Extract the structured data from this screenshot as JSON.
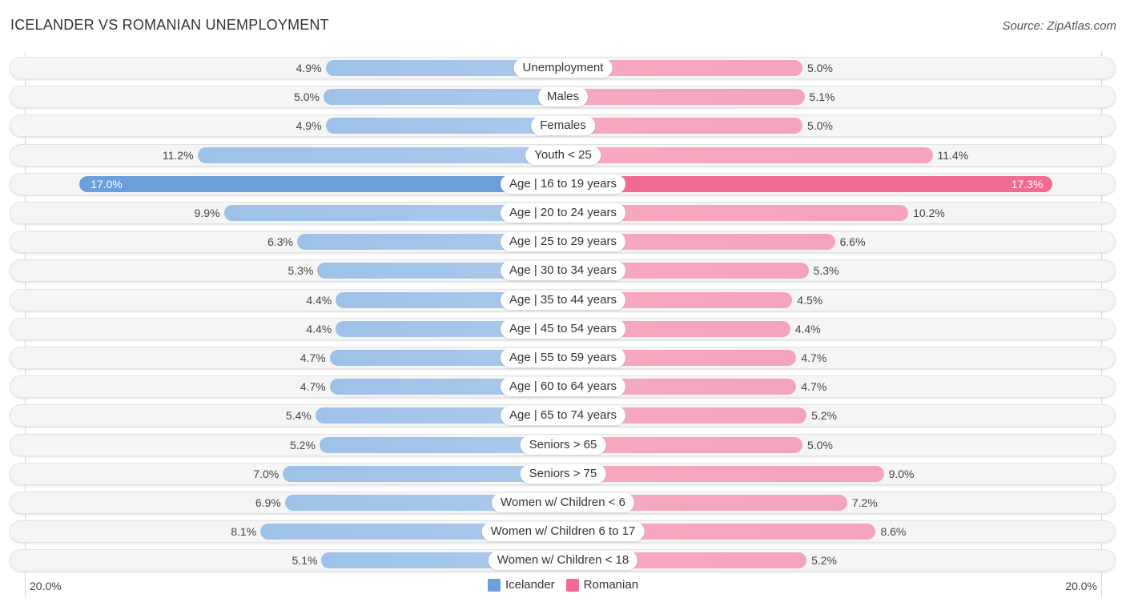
{
  "title": "ICELANDER VS ROMANIAN UNEMPLOYMENT",
  "source": "Source: ZipAtlas.com",
  "colors": {
    "icelander": "#6a9fdc",
    "romanian": "#f06a93"
  },
  "chart_data": {
    "type": "bar",
    "orientation": "horizontal-diverging",
    "title": "ICELANDER VS ROMANIAN UNEMPLOYMENT",
    "xlabel": "",
    "ylabel": "",
    "axis_range": [
      0,
      20.0
    ],
    "tick_labels": {
      "left": "20.0%",
      "right": "20.0%"
    },
    "legend": {
      "position": "bottom-center",
      "entries": [
        "Icelander",
        "Romanian"
      ]
    },
    "categories": [
      "Unemployment",
      "Males",
      "Females",
      "Youth < 25",
      "Age | 16 to 19 years",
      "Age | 20 to 24 years",
      "Age | 25 to 29 years",
      "Age | 30 to 34 years",
      "Age | 35 to 44 years",
      "Age | 45 to 54 years",
      "Age | 55 to 59 years",
      "Age | 60 to 64 years",
      "Age | 65 to 74 years",
      "Seniors > 65",
      "Seniors > 75",
      "Women w/ Children < 6",
      "Women w/ Children 6 to 17",
      "Women w/ Children < 18"
    ],
    "series": [
      {
        "name": "Icelander",
        "side": "left",
        "values": [
          4.9,
          5.0,
          4.9,
          11.2,
          17.0,
          9.9,
          6.3,
          5.3,
          4.4,
          4.4,
          4.7,
          4.7,
          5.4,
          5.2,
          7.0,
          6.9,
          8.1,
          5.1
        ],
        "labels": [
          "4.9%",
          "5.0%",
          "4.9%",
          "11.2%",
          "17.0%",
          "9.9%",
          "6.3%",
          "5.3%",
          "4.4%",
          "4.4%",
          "4.7%",
          "4.7%",
          "5.4%",
          "5.2%",
          "7.0%",
          "6.9%",
          "8.1%",
          "5.1%"
        ]
      },
      {
        "name": "Romanian",
        "side": "right",
        "values": [
          5.0,
          5.1,
          5.0,
          11.4,
          17.3,
          10.2,
          6.6,
          5.3,
          4.5,
          4.4,
          4.7,
          4.7,
          5.2,
          5.0,
          9.0,
          7.2,
          8.6,
          5.2
        ],
        "labels": [
          "5.0%",
          "5.1%",
          "5.0%",
          "11.4%",
          "17.3%",
          "10.2%",
          "6.6%",
          "5.3%",
          "4.5%",
          "4.4%",
          "4.7%",
          "4.7%",
          "5.2%",
          "5.0%",
          "9.0%",
          "7.2%",
          "8.6%",
          "5.2%"
        ]
      }
    ]
  }
}
